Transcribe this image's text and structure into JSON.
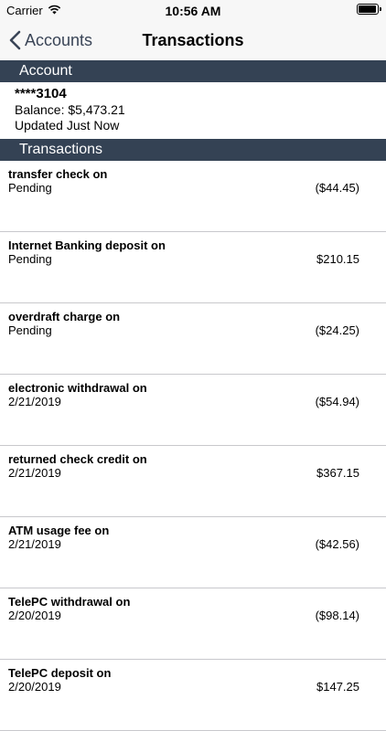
{
  "status_bar": {
    "carrier": "Carrier",
    "time": "10:56 AM"
  },
  "nav": {
    "back_label": "Accounts",
    "title": "Transactions"
  },
  "account_section": {
    "header": "Account",
    "number": "****3104",
    "balance": "Balance: $5,473.21",
    "updated": "Updated Just Now"
  },
  "transactions_section": {
    "header": "Transactions",
    "items": [
      {
        "description": "transfer check on",
        "date": "Pending",
        "amount": "($44.45)"
      },
      {
        "description": "Internet Banking deposit on",
        "date": "Pending",
        "amount": "$210.15"
      },
      {
        "description": "overdraft charge on",
        "date": "Pending",
        "amount": "($24.25)"
      },
      {
        "description": "electronic withdrawal on",
        "date": "2/21/2019",
        "amount": "($54.94)"
      },
      {
        "description": "returned check credit on",
        "date": "2/21/2019",
        "amount": "$367.15"
      },
      {
        "description": "ATM usage fee on",
        "date": "2/21/2019",
        "amount": "($42.56)"
      },
      {
        "description": "TelePC withdrawal on",
        "date": "2/20/2019",
        "amount": "($98.14)"
      },
      {
        "description": "TelePC deposit on",
        "date": "2/20/2019",
        "amount": "$147.25"
      }
    ]
  },
  "colors": {
    "section_header_bg": "#344254",
    "nav_tint": "#3a4557",
    "bar_bg": "#f7f7f7",
    "separator": "#c8c8cc"
  }
}
